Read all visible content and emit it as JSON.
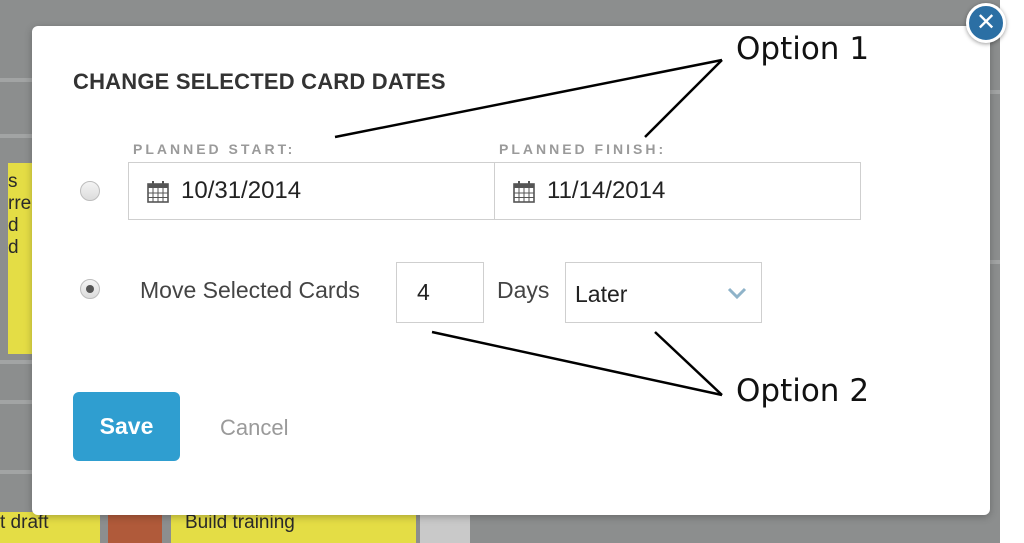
{
  "background": {
    "card_left_lines": [
      "s",
      "rre",
      "d d"
    ],
    "card_bottom_left": "t draft",
    "card_bottom_mid": "Build training"
  },
  "dialog": {
    "title": "CHANGE SELECTED CARD DATES",
    "close_icon": "close-x-icon",
    "option_dates": {
      "selected": false,
      "planned_start_label": "PLANNED START:",
      "planned_start_value": "10/31/2014",
      "planned_finish_label": "PLANNED FINISH:",
      "planned_finish_value": "11/14/2014"
    },
    "option_move": {
      "selected": true,
      "label": "Move Selected Cards",
      "days_value": "4",
      "days_label": "Days",
      "direction_value": "Later"
    },
    "save_label": "Save",
    "cancel_label": "Cancel"
  },
  "annotations": {
    "option1": "Option 1",
    "option2": "Option 2"
  },
  "colors": {
    "accent": "#2f9ed0",
    "close_button": "#2b6fa4",
    "card_yellow": "#e4dd45"
  }
}
